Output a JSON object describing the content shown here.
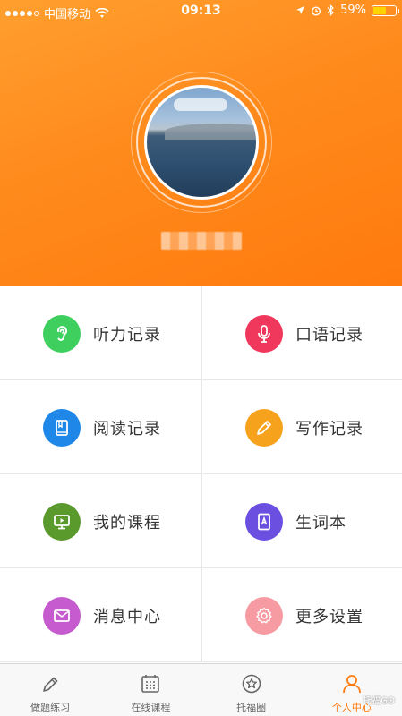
{
  "status_bar": {
    "carrier": "中国移动",
    "time": "09:13",
    "battery": "59%",
    "battery_level": 0.59
  },
  "profile": {
    "username": ""
  },
  "menu": [
    {
      "label": "听力记录",
      "icon": "ear-icon",
      "color": "#3fcf5f"
    },
    {
      "label": "口语记录",
      "icon": "microphone-icon",
      "color": "#f0385d"
    },
    {
      "label": "阅读记录",
      "icon": "book-icon",
      "color": "#1e87e8"
    },
    {
      "label": "写作记录",
      "icon": "pencil-icon",
      "color": "#f7a21d"
    },
    {
      "label": "我的课程",
      "icon": "video-lesson-icon",
      "color": "#5a9a2c"
    },
    {
      "label": "生词本",
      "icon": "vocabulary-book-icon",
      "color": "#6a4fe0"
    },
    {
      "label": "消息中心",
      "icon": "envelope-icon",
      "color": "#c65bd0"
    },
    {
      "label": "更多设置",
      "icon": "gear-icon",
      "color": "#f79ba3"
    }
  ],
  "tabbar": {
    "tabs": [
      {
        "label": "做题练习",
        "icon": "pen-icon",
        "active": false
      },
      {
        "label": "在线课程",
        "icon": "calendar-icon",
        "active": false
      },
      {
        "label": "托福圈",
        "icon": "star-circle-icon",
        "active": false
      },
      {
        "label": "个人中心",
        "icon": "person-icon",
        "active": true
      }
    ],
    "active_color": "#ff7a0e",
    "watermark": "托福GO"
  }
}
